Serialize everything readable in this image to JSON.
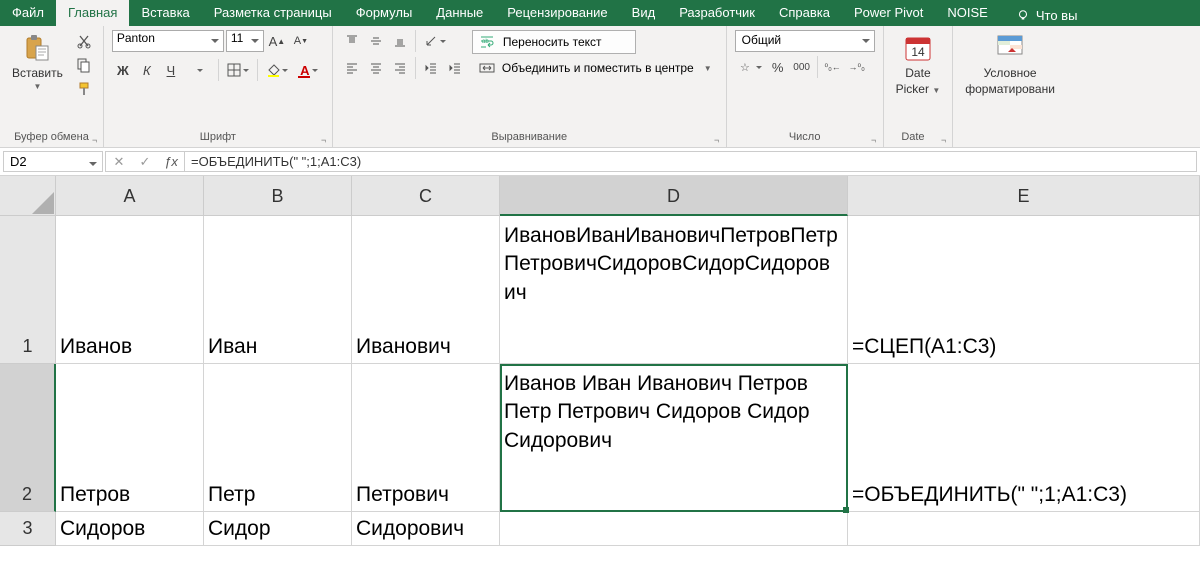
{
  "tabs": {
    "file": "Файл",
    "home": "Главная",
    "insert": "Вставка",
    "layout": "Разметка страницы",
    "formulas": "Формулы",
    "data": "Данные",
    "review": "Рецензирование",
    "view": "Вид",
    "developer": "Разработчик",
    "help": "Справка",
    "powerpivot": "Power Pivot",
    "noise": "NOISE",
    "tellme": "Что вы"
  },
  "ribbon": {
    "clipboard": {
      "label": "Буфер обмена",
      "paste": "Вставить"
    },
    "font": {
      "label": "Шрифт",
      "name": "Panton",
      "size": "11"
    },
    "alignment": {
      "label": "Выравнивание",
      "wrap": "Переносить текст",
      "merge": "Объединить и поместить в центре"
    },
    "number": {
      "label": "Число",
      "format": "Общий"
    },
    "date": {
      "label": "Date",
      "picker1": "Date",
      "picker2": "Picker"
    },
    "styles": {
      "cond1": "Условное",
      "cond2": "форматировани"
    }
  },
  "formula_bar": {
    "name_box": "D2",
    "formula": "=ОБЪЕДИНИТЬ(\" \";1;A1:C3)"
  },
  "columns": [
    "A",
    "B",
    "C",
    "D",
    "E"
  ],
  "rows": [
    "1",
    "2",
    "3"
  ],
  "cells": {
    "A1": "Иванов",
    "B1": "Иван",
    "C1": "Иванович",
    "D1": "ИвановИванИвановичПетровПетрПетровичСидоровСидорСидорович",
    "E1": "=СЦЕП(A1:C3)",
    "A2": "Петров",
    "B2": "Петр",
    "C2": "Петрович",
    "D2": "Иванов Иван Иванович Петров Петр Петрович Сидоров Сидор Сидорович",
    "E2": "=ОБЪЕДИНИТЬ(\" \";1;A1:C3)",
    "A3": "Сидоров",
    "B3": "Сидор",
    "C3": "Сидорович"
  },
  "date_day": "14"
}
